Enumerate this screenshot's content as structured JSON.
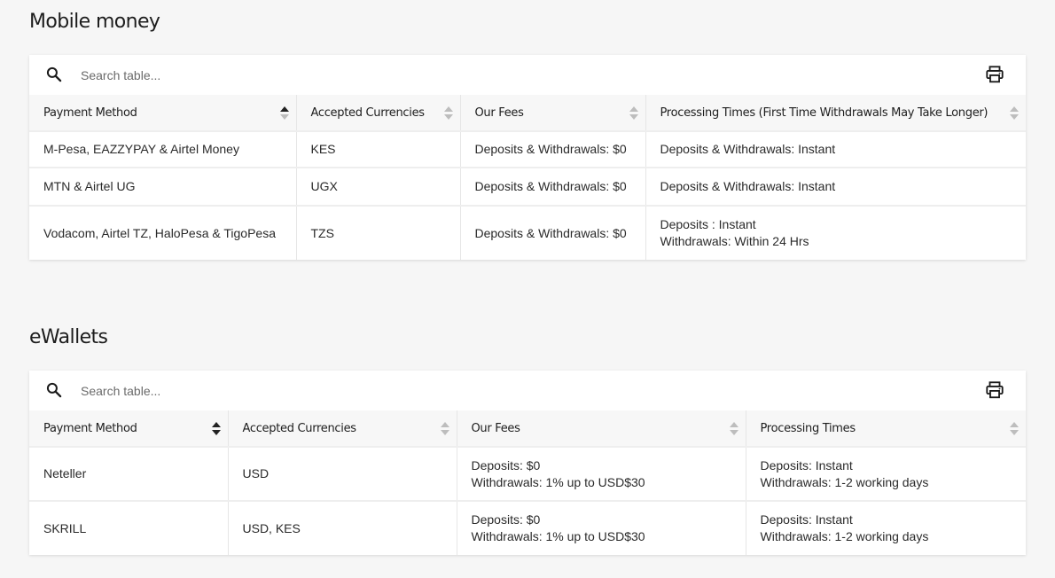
{
  "mobile": {
    "title": "Mobile money",
    "search_placeholder": "Search table...",
    "headers": [
      "Payment Method",
      "Accepted Currencies",
      "Our Fees",
      "Processing Times (First Time Withdrawals May Take Longer)"
    ],
    "rows": [
      {
        "method": "M-Pesa, EAZZYPAY & Airtel Money",
        "currencies": "KES",
        "fees": [
          "Deposits & Withdrawals: $0"
        ],
        "times": [
          "Deposits & Withdrawals: Instant"
        ]
      },
      {
        "method": "MTN & Airtel UG",
        "currencies": "UGX",
        "fees": [
          "Deposits & Withdrawals: $0"
        ],
        "times": [
          "Deposits & Withdrawals: Instant"
        ]
      },
      {
        "method": "Vodacom, Airtel TZ, HaloPesa & TigoPesa",
        "currencies": "TZS",
        "fees": [
          "Deposits & Withdrawals: $0"
        ],
        "times": [
          "Deposits : Instant",
          "Withdrawals: Within 24 Hrs"
        ]
      }
    ]
  },
  "ewallets": {
    "title": "eWallets",
    "search_placeholder": "Search table...",
    "headers": [
      "Payment Method",
      "Accepted Currencies",
      "Our Fees",
      "Processing Times"
    ],
    "rows": [
      {
        "method": "Neteller",
        "currencies": "USD",
        "fees": [
          "Deposits: $0",
          "Withdrawals: 1% up to USD$30"
        ],
        "times": [
          "Deposits: Instant",
          "Withdrawals: 1-2 working days"
        ]
      },
      {
        "method": "SKRILL",
        "currencies": "USD, KES",
        "fees": [
          "Deposits: $0",
          "Withdrawals: 1% up to USD$30"
        ],
        "times": [
          "Deposits: Instant",
          "Withdrawals: 1-2 working days"
        ]
      }
    ]
  },
  "icons": {
    "search": "search-icon",
    "print": "printer-icon",
    "sort": "sort-arrows-icon"
  }
}
